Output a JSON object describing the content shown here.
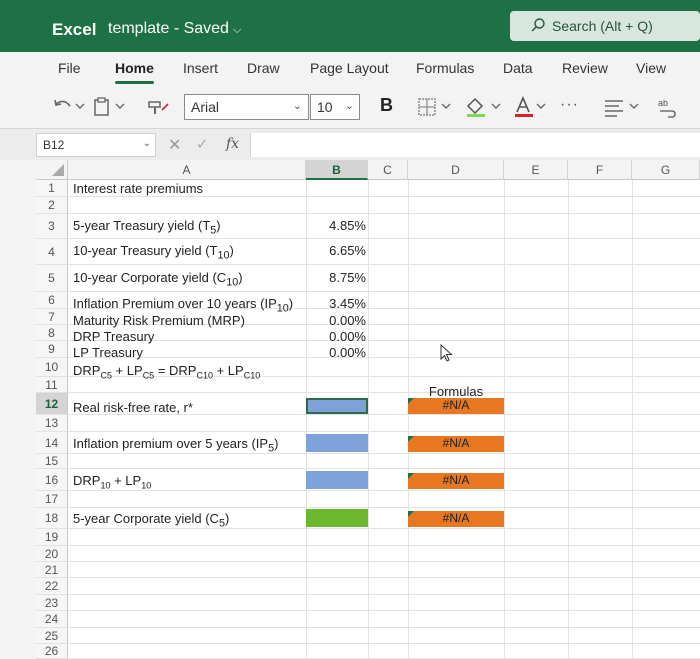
{
  "title_bar": {
    "app_name": "Excel",
    "doc_name": "template - Saved",
    "search_placeholder": "Search (Alt + Q)"
  },
  "ribbon_tabs": [
    "File",
    "Home",
    "Insert",
    "Draw",
    "Page Layout",
    "Formulas",
    "Data",
    "Review",
    "View"
  ],
  "active_tab": "Home",
  "toolbar": {
    "font_name": "Arial",
    "font_size": "10",
    "bold_label": "B"
  },
  "formula_bar": {
    "name_box": "B12",
    "fx_label": "fx",
    "formula": ""
  },
  "columns": [
    "A",
    "B",
    "C",
    "D",
    "E",
    "F",
    "G"
  ],
  "rows": [
    "1",
    "2",
    "3",
    "4",
    "5",
    "6",
    "7",
    "8",
    "9",
    "10",
    "11",
    "12",
    "13",
    "14",
    "15",
    "16",
    "17",
    "18",
    "19",
    "20",
    "21",
    "22",
    "23",
    "24",
    "25",
    "26"
  ],
  "cells": {
    "a1": "Interest rate premiums",
    "a3": "5-year Treasury yield (T",
    "a3_sub": "5",
    "a3_end": ")",
    "b3": "4.85%",
    "a4": "10-year Treasury yield (T",
    "a4_sub": "10",
    "a4_end": ")",
    "b4": "6.65%",
    "a5": "10-year Corporate yield (C",
    "a5_sub": "10",
    "a5_end": ")",
    "b5": "8.75%",
    "a6": "Inflation Premium over 10 years (IP",
    "a6_sub": "10",
    "a6_end": ")",
    "b6": "3.45%",
    "a7": "Maturity Risk Premium (MRP)",
    "b7": "0.00%",
    "a8": "DRP Treasury",
    "b8": "0.00%",
    "a9": "LP Treasury",
    "b9": "0.00%",
    "a10_p1": "DRP",
    "a10_s1": "C5",
    "a10_p2": " + LP",
    "a10_s2": "C5",
    "a10_p3": " = DRP",
    "a10_s3": "C10",
    "a10_p4": " + LP",
    "a10_s4": "C10",
    "d11": "Formulas",
    "a12": "Real risk-free rate, r*",
    "d12": "#N/A",
    "a14": "Inflation premium over 5 years (IP",
    "a14_sub": "5",
    "a14_end": ")",
    "d14": "#N/A",
    "a16_p1": "DRP",
    "a16_s1": "10",
    "a16_p2": " + LP",
    "a16_s2": "10",
    "d16": "#N/A",
    "a18": "5-year Corporate yield (C",
    "a18_sub": "5",
    "a18_end": ")",
    "d18": "#N/A"
  },
  "colors": {
    "brand": "#1e7145",
    "orange_fill": "#e87722",
    "blue_fill": "#7da1d9",
    "green_fill": "#6bb82e"
  }
}
